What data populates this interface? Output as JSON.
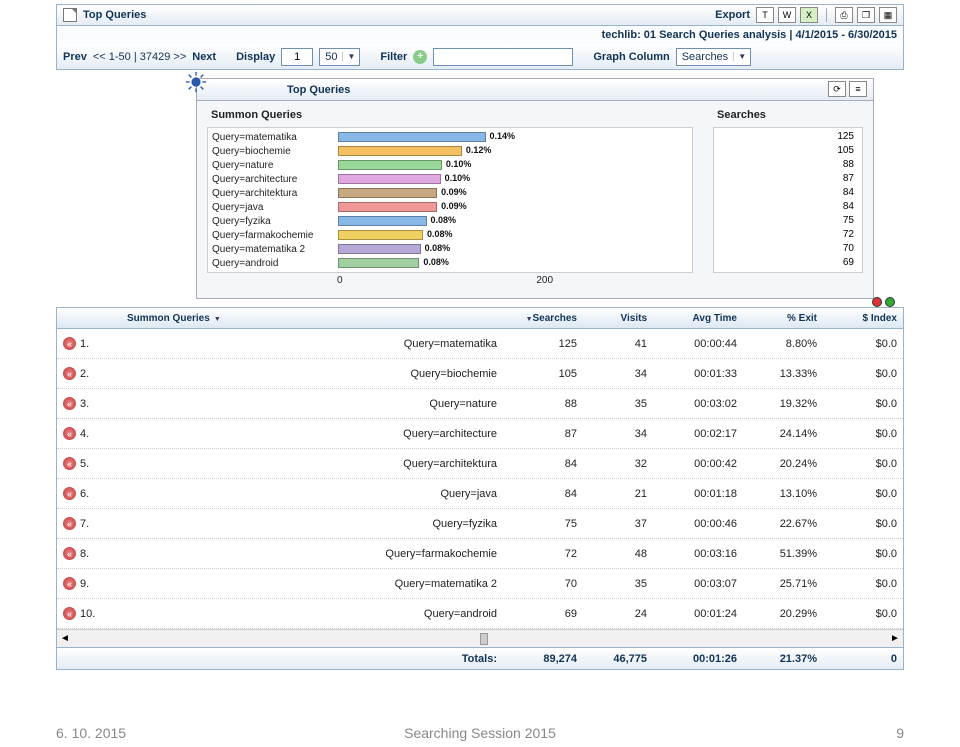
{
  "header": {
    "title": "Top Queries",
    "export_label": "Export",
    "subtitle": "techlib: 01 Search Queries analysis  |  4/1/2015 - 6/30/2015"
  },
  "toolbar": {
    "prev": "Prev",
    "next": "Next",
    "pagination": "<<  1-50  |  37429  >>",
    "display": "Display",
    "page": "1",
    "pagesize": "50",
    "filter": "Filter",
    "graph_column": "Graph Column",
    "graph_value": "Searches"
  },
  "chart_data": {
    "type": "bar",
    "title": "Top Queries",
    "left_title": "Summon Queries",
    "right_title": "Searches",
    "xlim": [
      0,
      300
    ],
    "xticks": [
      0,
      200
    ],
    "items": [
      {
        "label": "Query=matematika",
        "value": 125,
        "pct": "0.14%",
        "color": "#88b8e8"
      },
      {
        "label": "Query=biochemie",
        "value": 105,
        "pct": "0.12%",
        "color": "#f5c060"
      },
      {
        "label": "Query=nature",
        "value": 88,
        "pct": "0.10%",
        "color": "#98d898"
      },
      {
        "label": "Query=architecture",
        "value": 87,
        "pct": "0.10%",
        "color": "#e0a8e0"
      },
      {
        "label": "Query=architektura",
        "value": 84,
        "pct": "0.09%",
        "color": "#c8a880"
      },
      {
        "label": "Query=java",
        "value": 84,
        "pct": "0.09%",
        "color": "#f09898"
      },
      {
        "label": "Query=fyzika",
        "value": 75,
        "pct": "0.08%",
        "color": "#88b8e8"
      },
      {
        "label": "Query=farmakochemie",
        "value": 72,
        "pct": "0.08%",
        "color": "#f0d060"
      },
      {
        "label": "Query=matematika 2",
        "value": 70,
        "pct": "0.08%",
        "color": "#b8a8d8"
      },
      {
        "label": "Query=android",
        "value": 69,
        "pct": "0.08%",
        "color": "#a0d0a0"
      }
    ]
  },
  "table": {
    "columns": {
      "c1": "",
      "c2": "Summon Queries",
      "c3": "Searches",
      "c4": "Visits",
      "c5": "Avg Time",
      "c6": "% Exit",
      "c7": "$ Index"
    },
    "rows": [
      {
        "n": "1.",
        "query": "Query=matematika",
        "searches": "125",
        "visits": "41",
        "avg": "00:00:44",
        "exit": "8.80%",
        "idx": "$0.0"
      },
      {
        "n": "2.",
        "query": "Query=biochemie",
        "searches": "105",
        "visits": "34",
        "avg": "00:01:33",
        "exit": "13.33%",
        "idx": "$0.0"
      },
      {
        "n": "3.",
        "query": "Query=nature",
        "searches": "88",
        "visits": "35",
        "avg": "00:03:02",
        "exit": "19.32%",
        "idx": "$0.0"
      },
      {
        "n": "4.",
        "query": "Query=architecture",
        "searches": "87",
        "visits": "34",
        "avg": "00:02:17",
        "exit": "24.14%",
        "idx": "$0.0"
      },
      {
        "n": "5.",
        "query": "Query=architektura",
        "searches": "84",
        "visits": "32",
        "avg": "00:00:42",
        "exit": "20.24%",
        "idx": "$0.0"
      },
      {
        "n": "6.",
        "query": "Query=java",
        "searches": "84",
        "visits": "21",
        "avg": "00:01:18",
        "exit": "13.10%",
        "idx": "$0.0"
      },
      {
        "n": "7.",
        "query": "Query=fyzika",
        "searches": "75",
        "visits": "37",
        "avg": "00:00:46",
        "exit": "22.67%",
        "idx": "$0.0"
      },
      {
        "n": "8.",
        "query": "Query=farmakochemie",
        "searches": "72",
        "visits": "48",
        "avg": "00:03:16",
        "exit": "51.39%",
        "idx": "$0.0"
      },
      {
        "n": "9.",
        "query": "Query=matematika 2",
        "searches": "70",
        "visits": "35",
        "avg": "00:03:07",
        "exit": "25.71%",
        "idx": "$0.0"
      },
      {
        "n": "10.",
        "query": "Query=android",
        "searches": "69",
        "visits": "24",
        "avg": "00:01:24",
        "exit": "20.29%",
        "idx": "$0.0"
      }
    ],
    "totals": {
      "label": "Totals:",
      "searches": "89,274",
      "visits": "46,775",
      "avg": "00:01:26",
      "exit": "21.37%",
      "idx": "0"
    }
  },
  "footer": {
    "left": "6. 10. 2015",
    "center": "Searching Session 2015",
    "right": "9"
  }
}
